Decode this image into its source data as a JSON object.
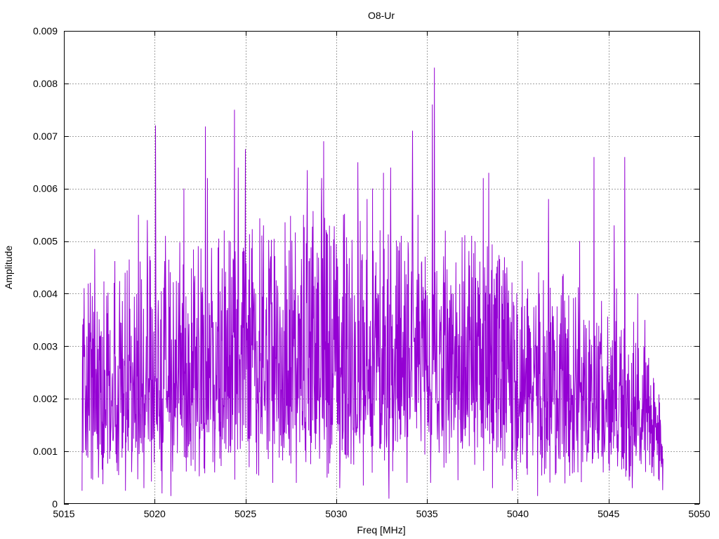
{
  "chart_data": {
    "type": "line",
    "title": "O8-Ur",
    "xlabel": "Freq [MHz]",
    "ylabel": "Amplitude",
    "xlim": [
      5015,
      5050
    ],
    "ylim": [
      0,
      0.009
    ],
    "grid": true,
    "line_color": "#9400d3",
    "xticks": [
      "5015",
      "5020",
      "5025",
      "5030",
      "5035",
      "5040",
      "5045",
      "5050"
    ],
    "yticks": [
      "0",
      "0.001",
      "0.002",
      "0.003",
      "0.004",
      "0.005",
      "0.006",
      "0.007",
      "0.008",
      "0.009"
    ],
    "series": [
      {
        "x_start": 5016.0,
        "x_end": 5048.0,
        "peaks": [
          [
            5016.7,
            0.00485
          ],
          [
            5017.8,
            0.00462
          ],
          [
            5018.6,
            0.00465
          ],
          [
            5019.1,
            0.0055
          ],
          [
            5019.6,
            0.0054
          ],
          [
            5020.05,
            0.0072
          ],
          [
            5020.6,
            0.0051
          ],
          [
            5021.6,
            0.006
          ],
          [
            5022.8,
            0.00718
          ],
          [
            5022.9,
            0.0062
          ],
          [
            5024.4,
            0.0075
          ],
          [
            5024.6,
            0.0064
          ],
          [
            5025.0,
            0.00675
          ],
          [
            5026.0,
            0.0053
          ],
          [
            5028.2,
            0.0055
          ],
          [
            5028.4,
            0.00635
          ],
          [
            5029.2,
            0.0062
          ],
          [
            5029.3,
            0.0069
          ],
          [
            5030.4,
            0.0055
          ],
          [
            5031.2,
            0.0065
          ],
          [
            5031.7,
            0.0058
          ],
          [
            5032.0,
            0.006
          ],
          [
            5032.6,
            0.0063
          ],
          [
            5033.0,
            0.0064
          ],
          [
            5034.2,
            0.0071
          ],
          [
            5034.5,
            0.0055
          ],
          [
            5035.3,
            0.0076
          ],
          [
            5035.4,
            0.0083
          ],
          [
            5036.0,
            0.0052
          ],
          [
            5038.1,
            0.0062
          ],
          [
            5038.4,
            0.0063
          ],
          [
            5039.4,
            0.0045
          ],
          [
            5041.7,
            0.0058
          ],
          [
            5043.4,
            0.005
          ],
          [
            5044.2,
            0.0066
          ],
          [
            5045.3,
            0.0053
          ],
          [
            5045.9,
            0.0066
          ],
          [
            5046.6,
            0.004
          ],
          [
            5047.0,
            0.0035
          ]
        ],
        "dips": [
          [
            5016.0,
            0.00025
          ],
          [
            5016.9,
            0.0005
          ],
          [
            5018.4,
            0.00025
          ],
          [
            5019.4,
            0.0003
          ],
          [
            5020.4,
            0.0002
          ],
          [
            5020.9,
            0.00015
          ],
          [
            5023.3,
            0.0006
          ],
          [
            5025.2,
            0.0007
          ],
          [
            5026.5,
            0.0004
          ],
          [
            5027.8,
            0.0004
          ],
          [
            5029.5,
            0.0005
          ],
          [
            5030.2,
            0.0003
          ],
          [
            5031.5,
            0.00035
          ],
          [
            5032.9,
            0.0001
          ],
          [
            5033.9,
            0.0004
          ],
          [
            5035.2,
            0.0004
          ],
          [
            5036.7,
            0.00045
          ],
          [
            5038.6,
            0.0003
          ],
          [
            5039.7,
            0.00025
          ],
          [
            5041.1,
            0.00015
          ],
          [
            5043.1,
            0.0006
          ],
          [
            5044.7,
            0.0006
          ],
          [
            5046.3,
            0.0003
          ],
          [
            5047.9,
            0.0007
          ]
        ]
      }
    ]
  }
}
